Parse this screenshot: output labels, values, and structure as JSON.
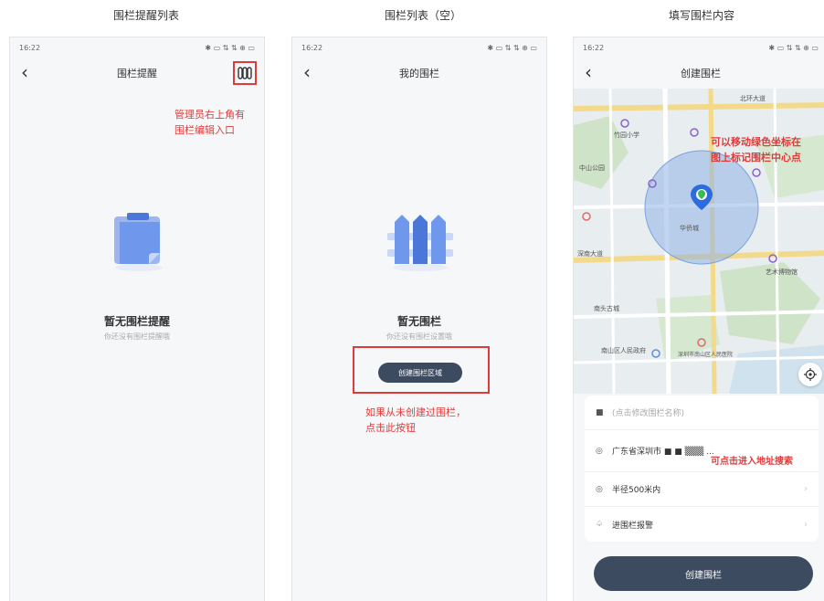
{
  "captions": {
    "left": "围栏提醒列表",
    "middle": "围栏列表（空）",
    "right": "填写围栏内容"
  },
  "statusbar": {
    "time": "16:22",
    "right_icons": "✱ ▭ ⇅ ⇅ ⊕ ▭"
  },
  "screen1": {
    "title": "围栏提醒",
    "annotation": [
      "管理员右上角有",
      "围栏编辑入口"
    ],
    "empty_title": "暂无围栏提醒",
    "empty_sub": "你还没有围栏提醒哦",
    "edit_icon": "fence-edit-icon"
  },
  "screen2": {
    "title": "我的围栏",
    "empty_title": "暂无围栏",
    "empty_sub": "你还没有围栏设置哦",
    "create_button": "创建围栏区域",
    "annotation": [
      "如果从未创建过围栏，",
      "点击此按钮"
    ]
  },
  "screen3": {
    "title": "创建围栏",
    "map_annotation": [
      "可以移动绿色坐标在",
      "图上标记围栏中心点"
    ],
    "address_annotation": "可点击进入地址搜索",
    "map_labels": [
      "北环大道",
      "竹园小学",
      "中山公园",
      "深南大道",
      "艺术博物馆",
      "南头古城",
      "深圳市南山区人民医院",
      "华侨城",
      "南山区人民政府"
    ],
    "fields": [
      {
        "icon": "■",
        "value": "(点击修改围栏名称)",
        "placeholder": true
      },
      {
        "icon": "◎",
        "value": "广东省深圳市 ■ ■ ▒▒▒ ...",
        "placeholder": false
      },
      {
        "icon": "◎",
        "value": "半径500米内",
        "placeholder": false
      },
      {
        "icon": "♤",
        "value": "进围栏报警",
        "placeholder": false
      }
    ],
    "create_button": "创建围栏"
  },
  "colors": {
    "annotation_red": "#e03b3b",
    "button_dark": "#3d4b61",
    "marker_blue": "#2d6cdf",
    "marker_green": "#3cba54"
  }
}
